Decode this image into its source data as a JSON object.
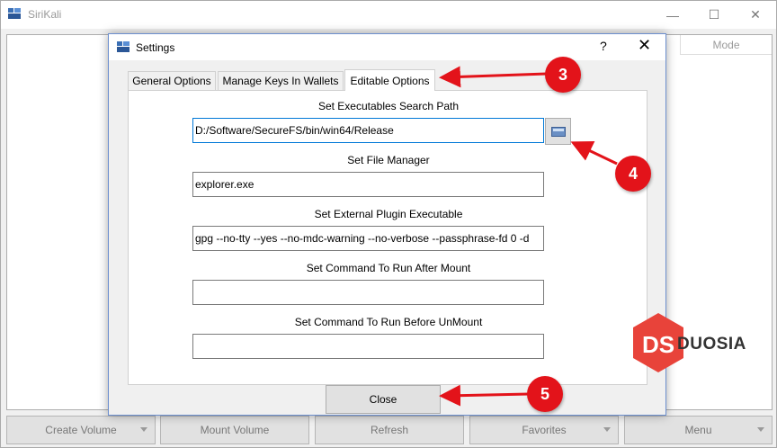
{
  "main_window": {
    "title": "SiriKali",
    "minimize_glyph": "—",
    "maximize_glyph": "☐",
    "close_glyph": "✕",
    "mode_header": "Mode"
  },
  "bottom_bar": {
    "buttons": [
      {
        "label": "Create Volume",
        "has_menu": true
      },
      {
        "label": "Mount Volume",
        "has_menu": false
      },
      {
        "label": "Refresh",
        "has_menu": false
      },
      {
        "label": "Favorites",
        "has_menu": true
      },
      {
        "label": "Menu",
        "has_menu": true
      }
    ]
  },
  "dialog": {
    "title": "Settings",
    "help_glyph": "?",
    "close_glyph": "✕",
    "tabs": [
      {
        "label": "General Options",
        "active": false
      },
      {
        "label": "Manage Keys In Wallets",
        "active": false
      },
      {
        "label": "Editable Options",
        "active": true
      }
    ],
    "fields": [
      {
        "label": "Set Executables Search Path",
        "value": "D:/Software/SecureFS/bin/win64/Release"
      },
      {
        "label": "Set File Manager",
        "value": "explorer.exe"
      },
      {
        "label": "Set External Plugin Executable",
        "value": "gpg --no-tty --yes --no-mdc-warning --no-verbose --passphrase-fd 0 -d"
      },
      {
        "label": "Set Command To Run After Mount",
        "value": ""
      },
      {
        "label": "Set Command To Run Before UnMount",
        "value": ""
      }
    ],
    "close_button": "Close"
  },
  "annotations": {
    "markers": [
      "3",
      "4",
      "5"
    ],
    "color": "#e3131a"
  },
  "watermark": {
    "logo_letters": "DS",
    "text": "DUOSIA",
    "color": "#e8433a"
  }
}
